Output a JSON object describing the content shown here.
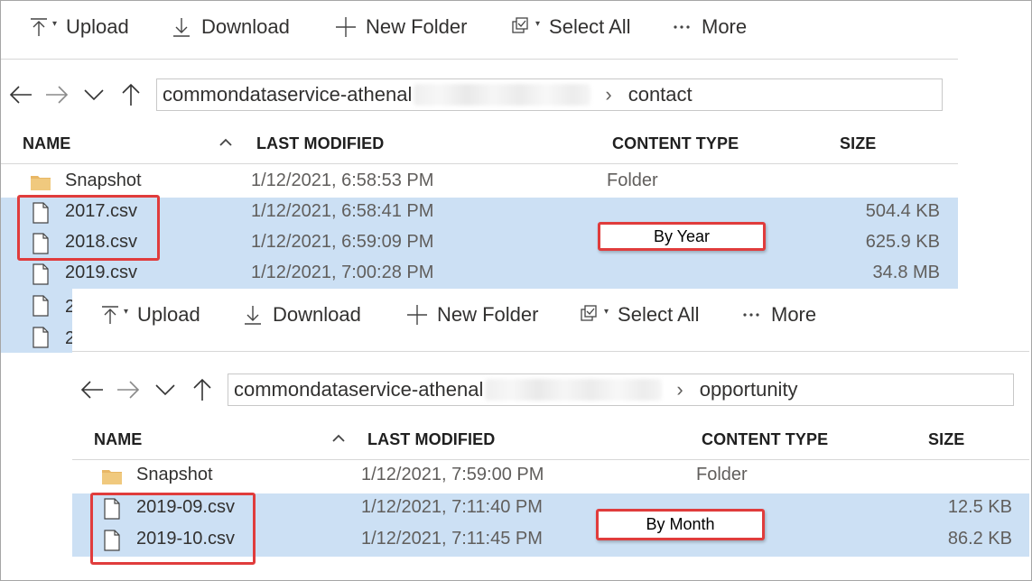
{
  "toolbar": {
    "upload_label": "Upload",
    "download_label": "Download",
    "new_folder_label": "New Folder",
    "select_all_label": "Select All",
    "more_label": "More"
  },
  "columns": {
    "name": "NAME",
    "last_modified": "LAST MODIFIED",
    "content_type": "CONTENT TYPE",
    "size": "SIZE"
  },
  "top_panel": {
    "path_prefix": "commondataservice-athenal",
    "path_current": "contact",
    "rows": [
      {
        "name": "Snapshot",
        "modified": "1/12/2021, 6:58:53 PM",
        "type": "Folder",
        "size": "",
        "icon": "folder-icon"
      },
      {
        "name": "2017.csv",
        "modified": "1/12/2021, 6:58:41 PM",
        "type": "",
        "size": "504.4 KB",
        "icon": "file-icon"
      },
      {
        "name": "2018.csv",
        "modified": "1/12/2021, 6:59:09 PM",
        "type": "",
        "size": "625.9 KB",
        "icon": "file-icon"
      },
      {
        "name": "2019.csv",
        "modified": "1/12/2021, 7:00:28 PM",
        "type": "",
        "size": "34.8 MB",
        "icon": "file-icon"
      }
    ],
    "partial_rows": [
      "2",
      "2"
    ],
    "callout_label": "By Year"
  },
  "bottom_panel": {
    "path_prefix": "commondataservice-athenal",
    "path_current": "opportunity",
    "rows": [
      {
        "name": "Snapshot",
        "modified": "1/12/2021, 7:59:00 PM",
        "type": "Folder",
        "size": "",
        "icon": "folder-icon"
      },
      {
        "name": "2019-09.csv",
        "modified": "1/12/2021, 7:11:40 PM",
        "type": "",
        "size": "12.5 KB",
        "icon": "file-icon"
      },
      {
        "name": "2019-10.csv",
        "modified": "1/12/2021, 7:11:45 PM",
        "type": "",
        "size": "86.2 KB",
        "icon": "file-icon"
      }
    ],
    "callout_label": "By Month"
  },
  "colors": {
    "selection": "#cce0f4",
    "callout_border": "#e03c3c",
    "folder": "#e8b765"
  }
}
